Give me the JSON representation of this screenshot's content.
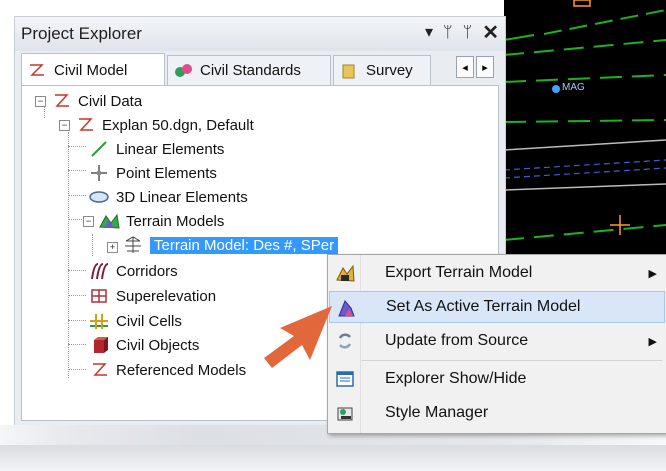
{
  "panel": {
    "title": "Project Explorer",
    "controls": [
      "▾",
      "ᛘ",
      "ᛘ",
      "✕"
    ]
  },
  "tabs": [
    {
      "label": "Civil Model"
    },
    {
      "label": "Civil Standards"
    },
    {
      "label": "Survey"
    }
  ],
  "tab_scroll": {
    "left": "◂",
    "right": "▸"
  },
  "tree": {
    "root": "Civil Data",
    "file": "Explan 50.dgn, Default",
    "items": [
      {
        "label": "Linear Elements"
      },
      {
        "label": "Point Elements"
      },
      {
        "label": "3D Linear Elements"
      },
      {
        "label": "Terrain Models"
      },
      {
        "label": "Terrain Model: Des #, SPer"
      },
      {
        "label": "Corridors"
      },
      {
        "label": "Superelevation"
      },
      {
        "label": "Civil Cells"
      },
      {
        "label": "Civil Objects"
      },
      {
        "label": "Referenced Models"
      }
    ],
    "expander_minus": "−",
    "expander_plus": "+"
  },
  "context_menu": {
    "items": [
      {
        "label": "Export Terrain Model",
        "submenu": "▶"
      },
      {
        "label": "Set As Active Terrain Model"
      },
      {
        "label": "Update from Source",
        "submenu": "▶"
      },
      {
        "label": "Explorer Show/Hide"
      },
      {
        "label": "Style Manager"
      }
    ]
  },
  "map": {
    "label": "MAG"
  },
  "colors": {
    "accent_arrow": "#e2683c",
    "selection": "#3399ff",
    "map_green": "#1db31d"
  }
}
